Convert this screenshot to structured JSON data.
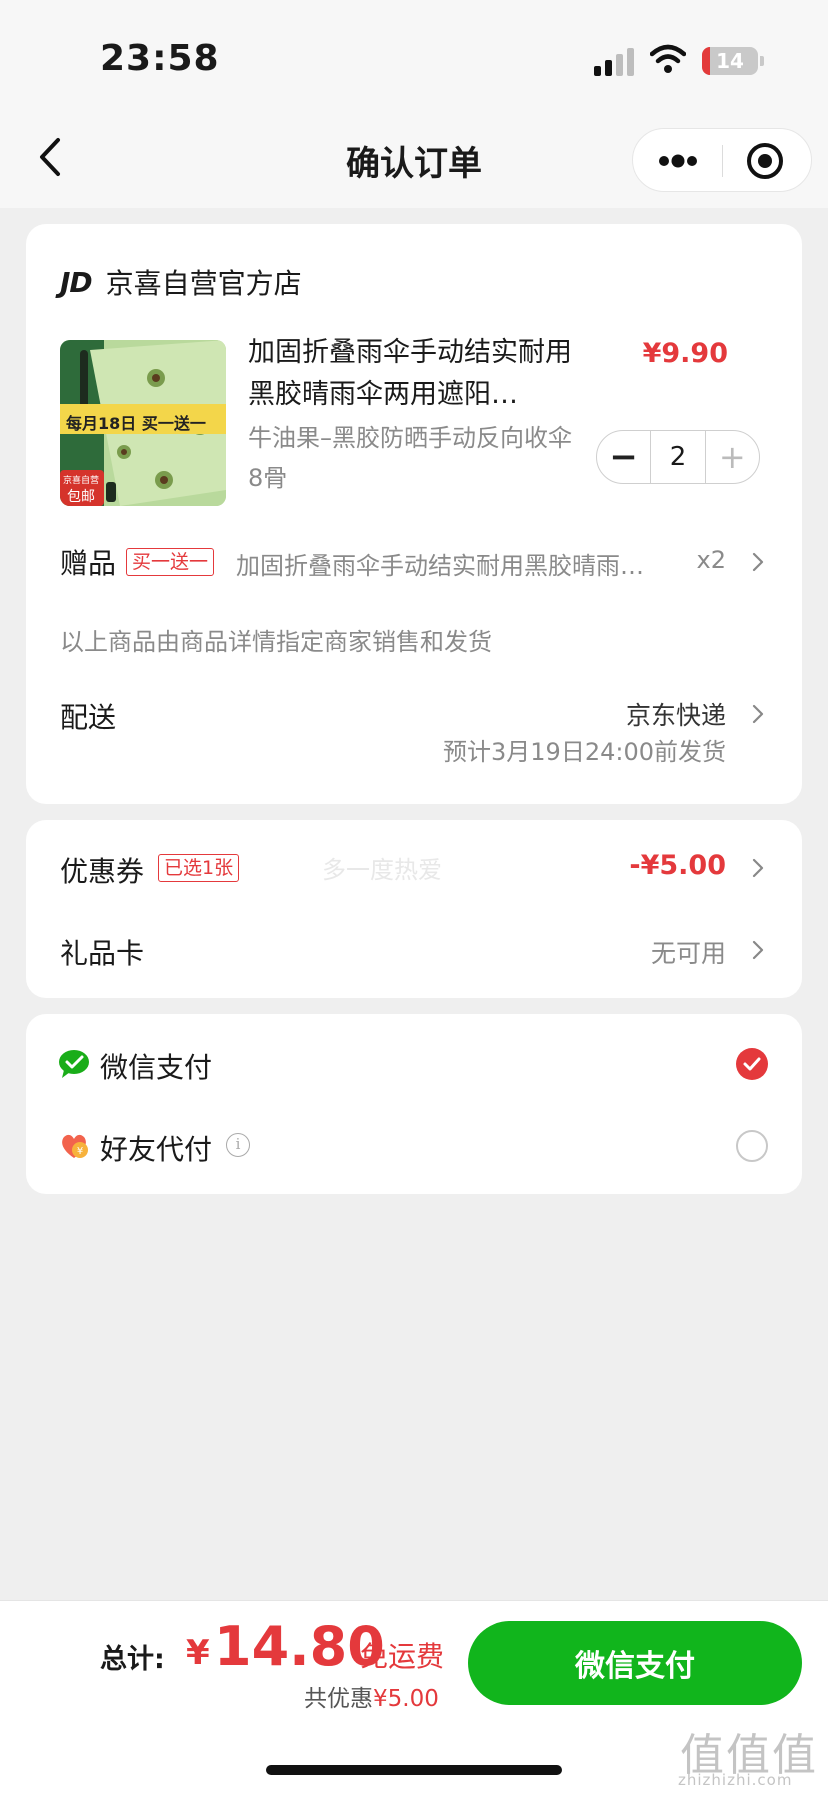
{
  "status_bar": {
    "time": "23:58",
    "battery": "14",
    "battery_level_pct": 14
  },
  "nav": {
    "title": "确认订单"
  },
  "store": {
    "logo": "JD",
    "name": "京喜自营官方店"
  },
  "product": {
    "name": "加固折叠雨伞手动结实耐用黑胶晴雨伞两用遮阳…",
    "price": "¥9.90",
    "spec": "牛油果–黑胶防晒手动反向收伞 8骨",
    "quantity": "2",
    "image_banner": "每月18日 买一送一",
    "image_badge_line1": "京喜自营",
    "image_badge_line2": "包邮"
  },
  "gift": {
    "label": "赠品",
    "tag": "买一送一",
    "desc": "加固折叠雨伞手动结实耐用黑胶晴雨…",
    "count": "x2"
  },
  "seller_note": "以上商品由商品详情指定商家销售和发货",
  "delivery": {
    "label": "配送",
    "method": "京东快递",
    "eta": "预计3月19日24:00前发货"
  },
  "coupon": {
    "label": "优惠券",
    "tag": "已选1张",
    "value": "-¥5.00",
    "watermark": "多一度热爱"
  },
  "giftcard": {
    "label": "礼品卡",
    "value": "无可用"
  },
  "payment": {
    "wechat_label": "微信支付",
    "friend_label": "好友代付",
    "info_glyph": "i",
    "selected": "wechat",
    "accent": "#e4393c",
    "wechat_green": "#11b51c"
  },
  "bottom": {
    "total_label": "总计:",
    "currency": "¥",
    "total_amount": "14.80",
    "free_shipping": "免运费",
    "saved_prefix": "共优惠",
    "saved_amount": "¥5.00",
    "pay_button": "微信支付"
  },
  "watermark": {
    "site": "值值值",
    "site_sub": "zhizhizhi.com"
  }
}
